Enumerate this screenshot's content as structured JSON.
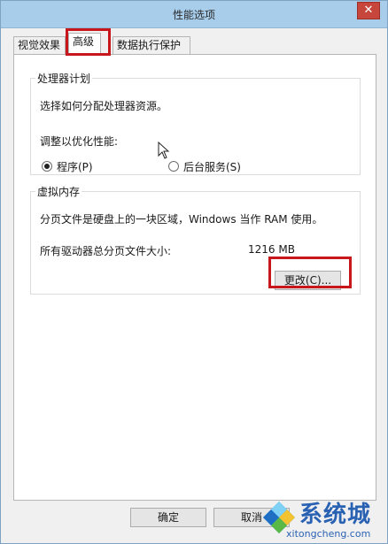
{
  "window": {
    "title": "性能选项",
    "close_glyph": "✕"
  },
  "tabs": [
    {
      "label": "视觉效果",
      "active": false
    },
    {
      "label": "高级",
      "active": true
    },
    {
      "label": "数据执行保护",
      "active": false
    }
  ],
  "processor": {
    "legend": "处理器计划",
    "description": "选择如何分配处理器资源。",
    "adjust_label": "调整以优化性能:",
    "options": [
      {
        "label": "程序(P)",
        "checked": true
      },
      {
        "label": "后台服务(S)",
        "checked": false
      }
    ]
  },
  "virtual_memory": {
    "legend": "虚拟内存",
    "description": "分页文件是硬盘上的一块区域，Windows 当作 RAM 使用。",
    "total_label": "所有驱动器总分页文件大小:",
    "total_value": "1216 MB",
    "change_button": "更改(C)..."
  },
  "footer": {
    "ok": "确定",
    "cancel": "取消"
  },
  "watermark": {
    "text": "系统城",
    "url": "xitongcheng.com"
  },
  "colors": {
    "highlight": "#c8161d",
    "titlebar": "#a7cdeb",
    "watermark": "#2a62b3"
  }
}
